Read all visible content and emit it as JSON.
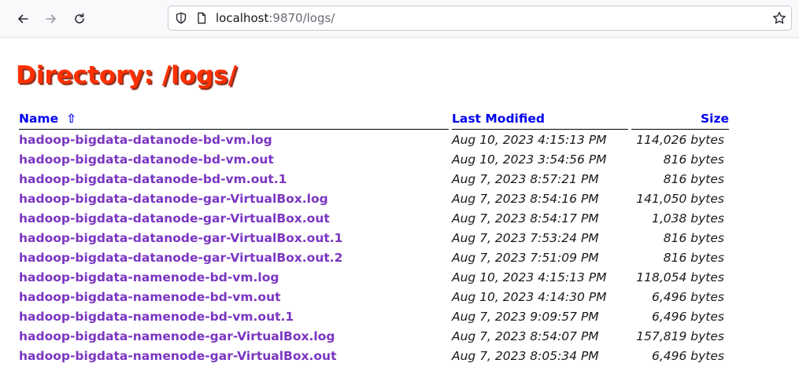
{
  "browser": {
    "url_host": "localhost",
    "url_port_path": ":9870/logs/"
  },
  "page": {
    "heading": "Directory: /logs/"
  },
  "table": {
    "headers": {
      "name": "Name",
      "sort_indicator": "⇧",
      "last_modified": "Last Modified",
      "size": "Size"
    },
    "rows": [
      {
        "name": "hadoop-bigdata-datanode-bd-vm.log",
        "modified": "Aug 10, 2023 4:15:13 PM",
        "size": "114,026 bytes"
      },
      {
        "name": "hadoop-bigdata-datanode-bd-vm.out",
        "modified": "Aug 10, 2023 3:54:56 PM",
        "size": "816 bytes"
      },
      {
        "name": "hadoop-bigdata-datanode-bd-vm.out.1",
        "modified": "Aug 7, 2023 8:57:21 PM",
        "size": "816 bytes"
      },
      {
        "name": "hadoop-bigdata-datanode-gar-VirtualBox.log",
        "modified": "Aug 7, 2023 8:54:16 PM",
        "size": "141,050 bytes"
      },
      {
        "name": "hadoop-bigdata-datanode-gar-VirtualBox.out",
        "modified": "Aug 7, 2023 8:54:17 PM",
        "size": "1,038 bytes"
      },
      {
        "name": "hadoop-bigdata-datanode-gar-VirtualBox.out.1",
        "modified": "Aug 7, 2023 7:53:24 PM",
        "size": "816 bytes"
      },
      {
        "name": "hadoop-bigdata-datanode-gar-VirtualBox.out.2",
        "modified": "Aug 7, 2023 7:51:09 PM",
        "size": "816 bytes"
      },
      {
        "name": "hadoop-bigdata-namenode-bd-vm.log",
        "modified": "Aug 10, 2023 4:15:13 PM",
        "size": "118,054 bytes"
      },
      {
        "name": "hadoop-bigdata-namenode-bd-vm.out",
        "modified": "Aug 10, 2023 4:14:30 PM",
        "size": "6,496 bytes"
      },
      {
        "name": "hadoop-bigdata-namenode-bd-vm.out.1",
        "modified": "Aug 7, 2023 9:09:57 PM",
        "size": "6,496 bytes"
      },
      {
        "name": "hadoop-bigdata-namenode-gar-VirtualBox.log",
        "modified": "Aug 7, 2023 8:54:07 PM",
        "size": "157,819 bytes"
      },
      {
        "name": "hadoop-bigdata-namenode-gar-VirtualBox.out",
        "modified": "Aug 7, 2023 8:05:34 PM",
        "size": "6,496 bytes"
      }
    ]
  },
  "colors": {
    "heading": "#ff3000",
    "header_link": "#0000ee",
    "file_link": "#7b36c1"
  },
  "icons": {
    "back": "arrow-left-icon",
    "forward": "arrow-right-icon",
    "reload": "reload-icon",
    "tracking": "shield-icon",
    "page": "page-icon",
    "bookmark": "star-icon"
  }
}
